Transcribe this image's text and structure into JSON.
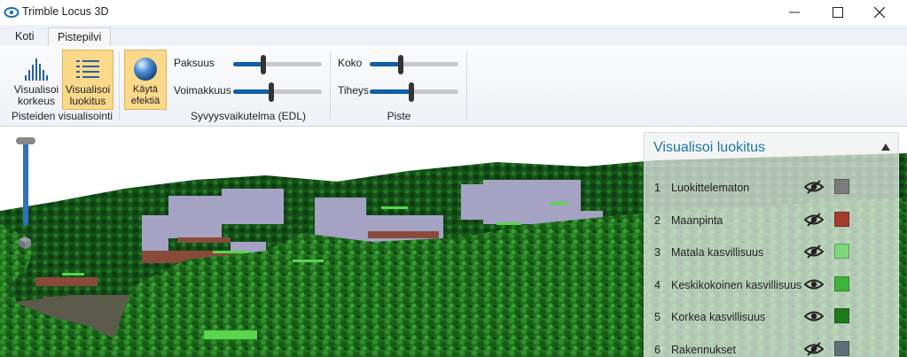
{
  "window": {
    "title": "Trimble Locus 3D"
  },
  "tabs": [
    {
      "label": "Koti"
    },
    {
      "label": "Pistepilvi"
    }
  ],
  "ribbon": {
    "btn_height": "Visualisoi korkeus",
    "btn_classify": "Visualisoi luokitus",
    "btn_effect": "Käytä efektiä",
    "group_points": "Pisteiden visualisointi",
    "group_edl": "Syvyysvaikutelma (EDL)",
    "group_point": "Piste",
    "sliders": {
      "paksuus": {
        "label": "Paksuus",
        "value": 0.34
      },
      "voimakkuus": {
        "label": "Voimakkuus",
        "value": 0.43
      },
      "koko": {
        "label": "Koko",
        "value": 0.35
      },
      "tiheys": {
        "label": "Tiheys",
        "value": 0.47
      }
    }
  },
  "viewport": {
    "zoom_level": 0.05
  },
  "panel": {
    "title": "Visualisoi luokitus",
    "classes": [
      {
        "num": "1",
        "name": "Luokittelematon",
        "visible": false,
        "color": "#7b7b7b"
      },
      {
        "num": "2",
        "name": "Maanpinta",
        "visible": false,
        "color": "#a33d2e"
      },
      {
        "num": "3",
        "name": "Matala kasvillisuus",
        "visible": false,
        "color": "#7fd67a"
      },
      {
        "num": "4",
        "name": "Keskikokoinen kasvillisuus",
        "visible": true,
        "color": "#3cb43a"
      },
      {
        "num": "5",
        "name": "Korkea kasvillisuus",
        "visible": true,
        "color": "#1f7a1c"
      },
      {
        "num": "6",
        "name": "Rakennukset",
        "visible": false,
        "color": "#5d6f78"
      }
    ]
  },
  "colors": {
    "accent": "#0f5ea8",
    "active_button": "#fbd98b",
    "panel_title": "#1b77a6"
  }
}
